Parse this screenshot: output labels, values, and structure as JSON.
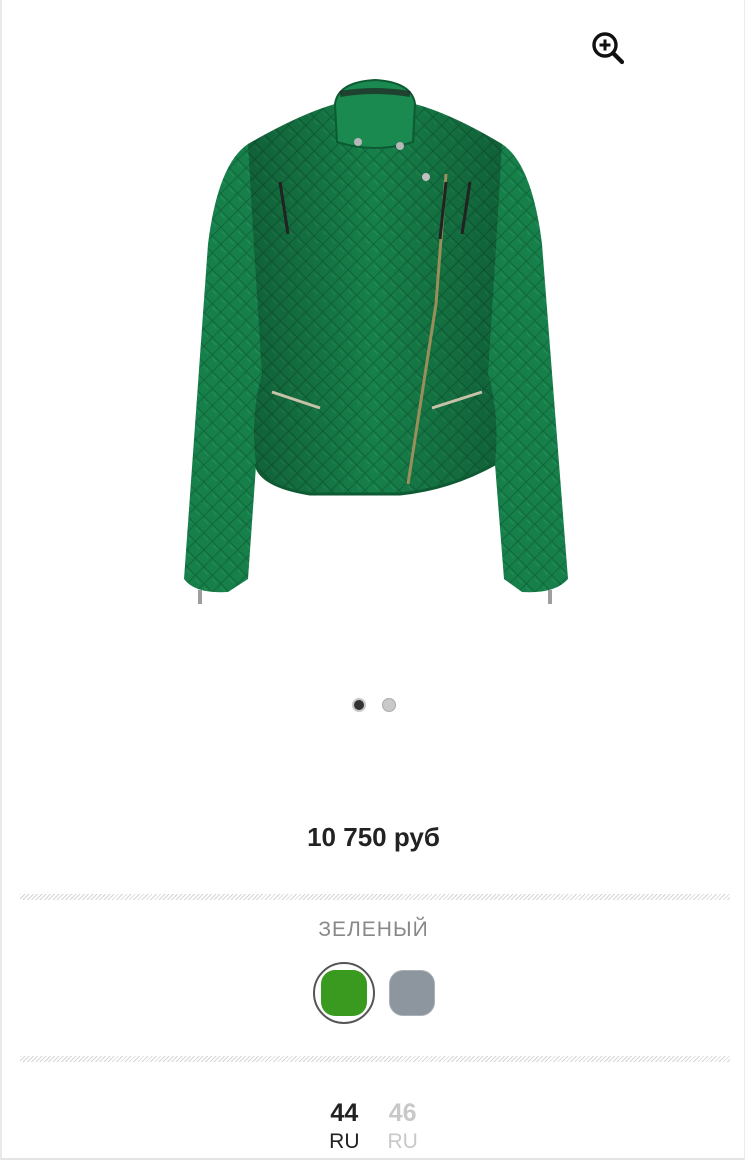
{
  "product": {
    "price": "10 750 руб",
    "image_count": 2,
    "active_image": 1,
    "jacket_color": "#16824c"
  },
  "zoom": {
    "icon": "zoom-in-icon"
  },
  "color": {
    "selected_name": "ЗЕЛЕНЫЙ",
    "swatches": [
      {
        "hex": "#3a9a1f",
        "selected": true
      },
      {
        "hex": "#8d969f",
        "selected": false
      }
    ]
  },
  "sizes": [
    {
      "value": "44",
      "unit": "RU",
      "available": true
    },
    {
      "value": "46",
      "unit": "RU",
      "available": false
    }
  ]
}
